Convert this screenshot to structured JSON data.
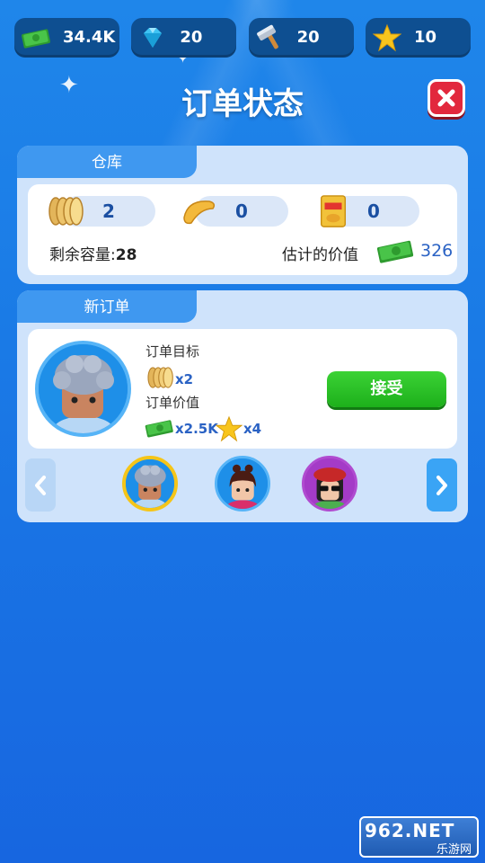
{
  "resources": {
    "cash": "34.4K",
    "gems": "20",
    "hammers": "20",
    "stars": "10"
  },
  "title": "订单状态",
  "warehouse": {
    "tab": "仓库",
    "items": [
      {
        "icon": "cookie-stack-icon",
        "count": "2"
      },
      {
        "icon": "chip-icon",
        "count": "0"
      },
      {
        "icon": "chip-bag-icon",
        "count": "0"
      }
    ],
    "capacity_label": "剩余容量:",
    "capacity_value": "28",
    "value_label": "估计的价值",
    "value_amount": "326"
  },
  "new_orders": {
    "tab": "新订单",
    "target_label": "订单目标",
    "target_qty": "x2",
    "value_label": "订单价值",
    "reward_cash": "x2.5K",
    "reward_stars": "x4",
    "accept_label": "接受"
  },
  "watermark": {
    "top": "962.NET",
    "bottom": "乐游网"
  },
  "colors": {
    "accent_blue": "#3f98f0",
    "accept_green": "#1db01b",
    "close_red": "#e2283d",
    "selected_ring": "#f5c518"
  }
}
